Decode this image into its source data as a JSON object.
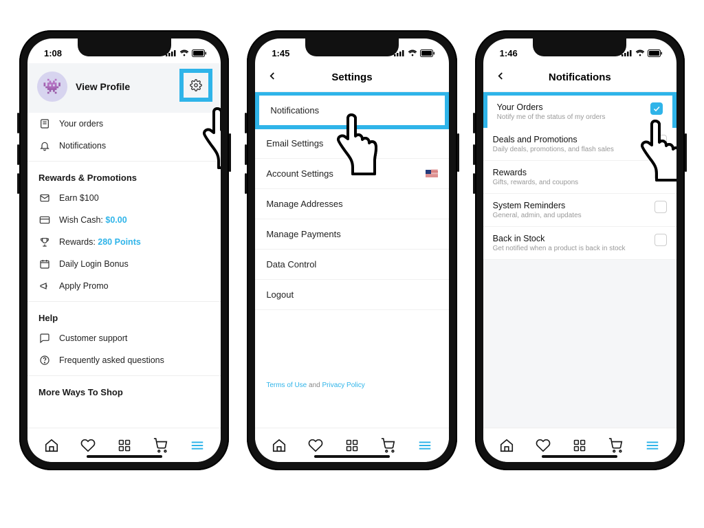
{
  "phone1": {
    "time": "1:08",
    "profile_label": "View Profile",
    "avatar_emoji": "👾",
    "rows_top": [
      {
        "icon": "receipt-icon",
        "label": "Your orders"
      },
      {
        "icon": "bell-icon",
        "label": "Notifications"
      }
    ],
    "section_rewards": "Rewards & Promotions",
    "rewards_rows": [
      {
        "icon": "mail-icon",
        "label": "Earn $100"
      },
      {
        "icon": "card-icon",
        "label_prefix": "Wish Cash: ",
        "value": "$0.00"
      },
      {
        "icon": "trophy-icon",
        "label_prefix": "Rewards: ",
        "value": "280 Points"
      },
      {
        "icon": "calendar-icon",
        "label": "Daily Login Bonus"
      },
      {
        "icon": "megaphone-icon",
        "label": "Apply Promo"
      }
    ],
    "section_help": "Help",
    "help_rows": [
      {
        "icon": "chat-icon",
        "label": "Customer support"
      },
      {
        "icon": "question-icon",
        "label": "Frequently asked questions"
      }
    ],
    "section_more": "More Ways To Shop"
  },
  "phone2": {
    "time": "1:45",
    "title": "Settings",
    "rows": [
      "Notifications",
      "Email Settings",
      "Account Settings",
      "Manage Addresses",
      "Manage Payments",
      "Data Control",
      "Logout"
    ],
    "footer": {
      "terms": "Terms of Use",
      "and": " and ",
      "privacy": "Privacy Policy"
    }
  },
  "phone3": {
    "time": "1:46",
    "title": "Notifications",
    "rows": [
      {
        "title": "Your Orders",
        "sub": "Notify me of the status of my orders",
        "checked": true,
        "highlight": true
      },
      {
        "title": "Deals and Promotions",
        "sub": "Daily deals, promotions, and flash sales",
        "checked": false
      },
      {
        "title": "Rewards",
        "sub": "Gifts, rewards, and coupons",
        "checked": false
      },
      {
        "title": "System Reminders",
        "sub": "General, admin, and updates",
        "checked": false
      },
      {
        "title": "Back in Stock",
        "sub": "Get notified when a product is back in stock",
        "checked": false
      }
    ]
  }
}
